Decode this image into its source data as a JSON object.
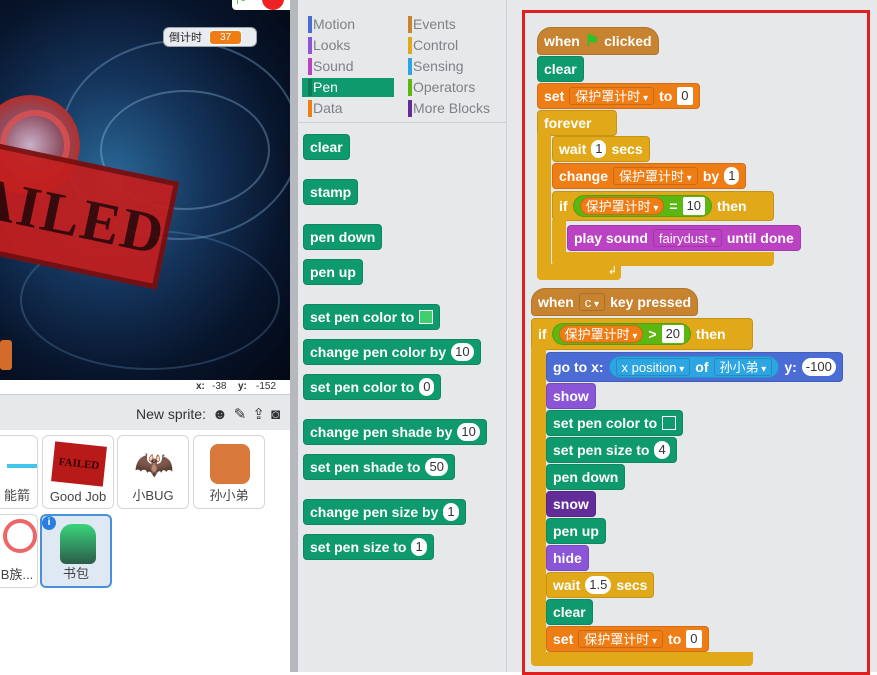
{
  "stage": {
    "monitor_label": "倒计时",
    "monitor_value": "37",
    "stamp_text": "AILED",
    "x_label": "x:",
    "x_value": "-38",
    "y_label": "y:",
    "y_value": "-152"
  },
  "sprites": {
    "new_sprite_label": "New sprite:",
    "tiles": [
      "能箭",
      "Good Job",
      "小BUG",
      "孙小弟",
      "B族...",
      "书包"
    ],
    "good_job_art_text": "FAILED"
  },
  "categories": {
    "left": [
      {
        "label": "Motion",
        "color": "#4a6cd4"
      },
      {
        "label": "Looks",
        "color": "#8a55d7"
      },
      {
        "label": "Sound",
        "color": "#bb42c3"
      },
      {
        "label": "Pen",
        "color": "#0e9a6c",
        "selected": true
      },
      {
        "label": "Data",
        "color": "#ee7d16"
      }
    ],
    "right": [
      {
        "label": "Events",
        "color": "#c88330"
      },
      {
        "label": "Control",
        "color": "#e1a91a"
      },
      {
        "label": "Sensing",
        "color": "#2ca5e2"
      },
      {
        "label": "Operators",
        "color": "#5cb712"
      },
      {
        "label": "More Blocks",
        "color": "#632d99"
      }
    ]
  },
  "palette": {
    "clear": "clear",
    "stamp": "stamp",
    "pen_down": "pen down",
    "pen_up": "pen up",
    "set_color_to": "set pen color to",
    "change_color_by": "change pen color by",
    "change_color_val": "10",
    "set_color_num": "set pen color to",
    "set_color_num_val": "0",
    "change_shade_by": "change pen shade by",
    "change_shade_val": "10",
    "set_shade_to": "set pen shade to",
    "set_shade_val": "50",
    "change_size_by": "change pen size by",
    "change_size_val": "1",
    "set_size_to": "set pen size to",
    "set_size_val": "1"
  },
  "script1": {
    "when": "when",
    "clicked": "clicked",
    "clear": "clear",
    "set": "set",
    "var": "保护罩计时",
    "to": "to",
    "set_val": "0",
    "forever": "forever",
    "wait": "wait",
    "wait_val": "1",
    "secs": "secs",
    "change": "change",
    "by": "by",
    "change_val": "1",
    "if": "if",
    "eq_sym": "=",
    "eq_val": "10",
    "then": "then",
    "play_sound": "play sound",
    "sound_name": "fairydust",
    "until_done": "until done"
  },
  "script2": {
    "when": "when",
    "key": "c",
    "key_pressed": "key pressed",
    "if": "if",
    "gt_sym": ">",
    "gt_val": "20",
    "then": "then",
    "goto": "go to x:",
    "x_position": "x position",
    "of": "of",
    "sprite": "孙小弟",
    "y": "y:",
    "y_val": "-100",
    "show": "show",
    "set_color": "set pen color to",
    "set_size": "set pen size to",
    "size_val": "4",
    "pen_down": "pen down",
    "snow": "snow",
    "pen_up": "pen up",
    "hide": "hide",
    "wait": "wait",
    "wait_val": "1.5",
    "secs": "secs",
    "clear": "clear",
    "set": "set",
    "var": "保护罩计时",
    "to": "to",
    "set_val": "0"
  }
}
